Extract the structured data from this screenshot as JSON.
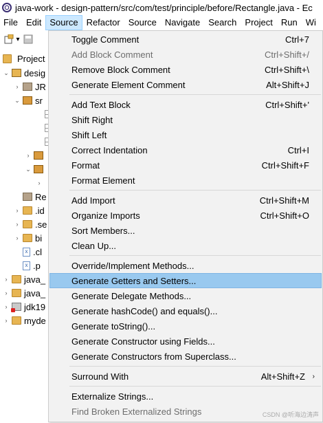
{
  "window": {
    "title": "java-work - design-pattern/src/com/test/principle/before/Rectangle.java - Ec"
  },
  "menubar": {
    "items": [
      {
        "label": "File"
      },
      {
        "label": "Edit"
      },
      {
        "label": "Source",
        "active": true
      },
      {
        "label": "Refactor"
      },
      {
        "label": "Source"
      },
      {
        "label": "Navigate"
      },
      {
        "label": "Search"
      },
      {
        "label": "Project"
      },
      {
        "label": "Run"
      },
      {
        "label": "Wi"
      }
    ]
  },
  "explorer": {
    "title": "Project",
    "rows": [
      {
        "label": "desig",
        "icon": "project-icon",
        "chevron": "v"
      },
      {
        "label": "JR",
        "icon": "library-icon",
        "chevron": ">"
      },
      {
        "label": "sr",
        "icon": "source-folder-icon",
        "chevron": "v"
      },
      {
        "label": "",
        "icon": "class-icon",
        "chevron": ""
      },
      {
        "label": "",
        "icon": "class-icon",
        "chevron": ""
      },
      {
        "label": "",
        "icon": "class-icon",
        "chevron": ""
      },
      {
        "label": "",
        "icon": "package-icon",
        "chevron": ">"
      },
      {
        "label": "",
        "icon": "package-icon",
        "chevron": "v"
      },
      {
        "label": "",
        "icon": "",
        "chevron": ">"
      },
      {
        "label": "Re",
        "icon": "library-icon",
        "chevron": ""
      },
      {
        "label": ".id",
        "icon": "folder-icon",
        "chevron": ">"
      },
      {
        "label": ".se",
        "icon": "folder-icon",
        "chevron": ">"
      },
      {
        "label": "bi",
        "icon": "folder-icon",
        "chevron": ">"
      },
      {
        "label": ".cl",
        "icon": "xml-file-icon",
        "chevron": ""
      },
      {
        "label": ".p",
        "icon": "xml-file-icon",
        "chevron": ""
      },
      {
        "label": "java_",
        "icon": "folder-icon",
        "chevron": ">"
      },
      {
        "label": "java_",
        "icon": "folder-icon",
        "chevron": ">"
      },
      {
        "label": "jdk19",
        "icon": "jdk-icon",
        "chevron": ">"
      },
      {
        "label": "myde",
        "icon": "folder-icon",
        "chevron": ">"
      }
    ]
  },
  "source_menu": {
    "groups": [
      [
        {
          "label": "Toggle Comment",
          "accel": "Ctrl+7",
          "enabled": true
        },
        {
          "label": "Add Block Comment",
          "accel": "Ctrl+Shift+/",
          "enabled": false
        },
        {
          "label": "Remove Block Comment",
          "accel": "Ctrl+Shift+\\",
          "enabled": true
        },
        {
          "label": "Generate Element Comment",
          "accel": "Alt+Shift+J",
          "enabled": true
        }
      ],
      [
        {
          "label": "Add Text Block",
          "accel": "Ctrl+Shift+'",
          "enabled": true
        },
        {
          "label": "Shift Right",
          "accel": "",
          "enabled": true
        },
        {
          "label": "Shift Left",
          "accel": "",
          "enabled": true
        },
        {
          "label": "Correct Indentation",
          "accel": "Ctrl+I",
          "enabled": true
        },
        {
          "label": "Format",
          "accel": "Ctrl+Shift+F",
          "enabled": true
        },
        {
          "label": "Format Element",
          "accel": "",
          "enabled": true
        }
      ],
      [
        {
          "label": "Add Import",
          "accel": "Ctrl+Shift+M",
          "enabled": true
        },
        {
          "label": "Organize Imports",
          "accel": "Ctrl+Shift+O",
          "enabled": true
        },
        {
          "label": "Sort Members...",
          "accel": "",
          "enabled": true
        },
        {
          "label": "Clean Up...",
          "accel": "",
          "enabled": true
        }
      ],
      [
        {
          "label": "Override/Implement Methods...",
          "accel": "",
          "enabled": true
        },
        {
          "label": "Generate Getters and Setters...",
          "accel": "",
          "enabled": true,
          "highlighted": true
        },
        {
          "label": "Generate Delegate Methods...",
          "accel": "",
          "enabled": true
        },
        {
          "label": "Generate hashCode() and equals()...",
          "accel": "",
          "enabled": true
        },
        {
          "label": "Generate toString()...",
          "accel": "",
          "enabled": true
        },
        {
          "label": "Generate Constructor using Fields...",
          "accel": "",
          "enabled": true
        },
        {
          "label": "Generate Constructors from Superclass...",
          "accel": "",
          "enabled": true
        }
      ],
      [
        {
          "label": "Surround With",
          "accel": "Alt+Shift+Z",
          "enabled": true,
          "submenu": true
        }
      ],
      [
        {
          "label": "Externalize Strings...",
          "accel": "",
          "enabled": true
        },
        {
          "label": "Find Broken Externalized Strings",
          "accel": "",
          "enabled": false
        }
      ]
    ]
  },
  "watermark": "CSDN @听海边涛声",
  "colors": {
    "menu_background": "#f2f2f2",
    "highlight": "#99c9ef",
    "active_menu": "#cce8ff",
    "disabled_text": "#6d6d6d"
  }
}
